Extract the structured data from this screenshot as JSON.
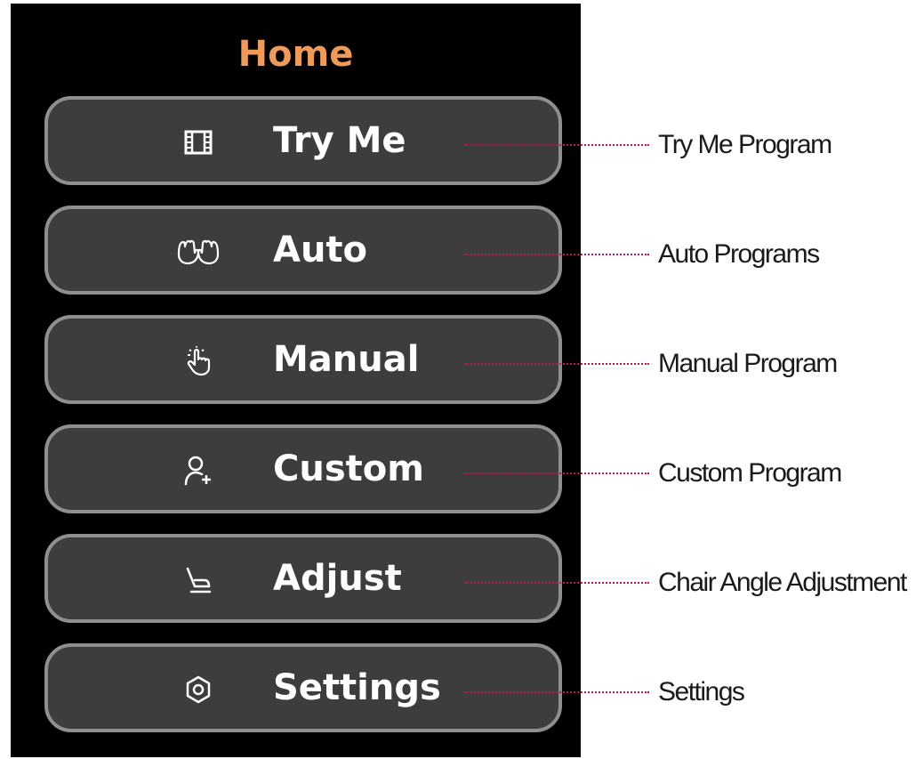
{
  "screen": {
    "title": "Home",
    "title_color": "#ee9a5a",
    "background_color": "#000000",
    "button_color": "#3d3d3d",
    "button_border_color": "#8f8f8f"
  },
  "menu": {
    "items": [
      {
        "label": "Try Me",
        "icon": "film-icon"
      },
      {
        "label": "Auto",
        "icon": "hands-icon"
      },
      {
        "label": "Manual",
        "icon": "tap-hand-icon"
      },
      {
        "label": "Custom",
        "icon": "user-add-icon"
      },
      {
        "label": "Adjust",
        "icon": "chair-icon"
      },
      {
        "label": "Settings",
        "icon": "settings-hexagon-icon"
      }
    ]
  },
  "annotations": {
    "leader_color": "#c0144c",
    "items": [
      "Try Me Program",
      "Auto Programs",
      "Manual Program",
      "Custom Program",
      "Chair Angle Adjustment",
      "Settings"
    ]
  }
}
